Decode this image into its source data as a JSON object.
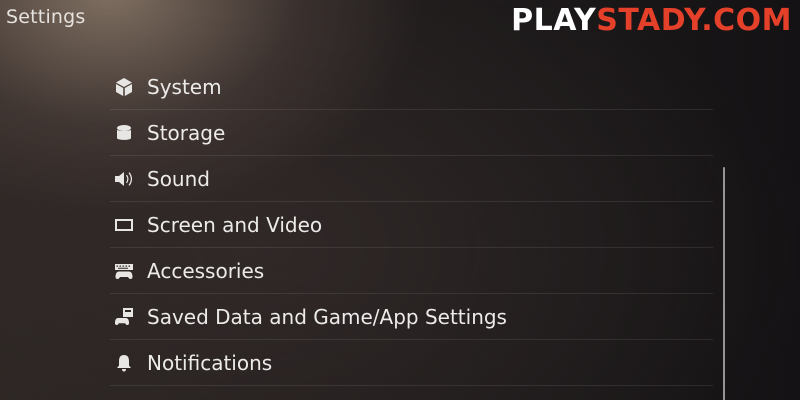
{
  "header": {
    "title": "Settings"
  },
  "watermark": {
    "part1": "PLAY",
    "part2": "STADY.COM",
    "colors": {
      "part1": "#ffffff",
      "part2": "#e4402a"
    }
  },
  "settings": {
    "items": [
      {
        "label": "System",
        "icon": "cube-icon"
      },
      {
        "label": "Storage",
        "icon": "storage-icon"
      },
      {
        "label": "Sound",
        "icon": "speaker-icon"
      },
      {
        "label": "Screen and Video",
        "icon": "screen-icon"
      },
      {
        "label": "Accessories",
        "icon": "gamepad-keyboard-icon"
      },
      {
        "label": "Saved Data and Game/App Settings",
        "icon": "saved-data-icon"
      },
      {
        "label": "Notifications",
        "icon": "bell-icon"
      }
    ]
  },
  "colors": {
    "text": "#e8e6e4",
    "background_dark": "#141214"
  }
}
